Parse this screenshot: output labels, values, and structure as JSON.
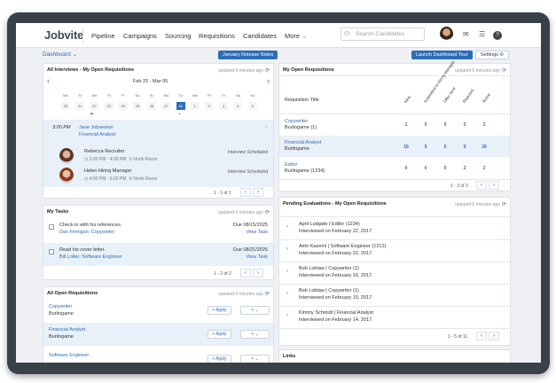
{
  "app": {
    "logo": "Jobvite"
  },
  "nav": {
    "items": [
      "Pipeline",
      "Campaigns",
      "Sourcing",
      "Requisitions",
      "Candidates",
      "More"
    ],
    "more_chevron": "⌄",
    "search_placeholder": "Search Candidates",
    "search_icon_glyph": "⚇",
    "mail_glyph": "✉",
    "list_glyph": "☰",
    "help_glyph": "?"
  },
  "subbar": {
    "dashboard": "Dashboard ⌄",
    "release_notes": "January Release Notes",
    "launch_tour": "Launch Dashboard Tour",
    "settings": "Settings",
    "settings_icon": "⚙"
  },
  "interviews": {
    "title": "All Interviews - My Open Requisitions",
    "updated": "updated 6 minutes ago",
    "refresh": "⟳",
    "range": "Feb 20 - Mar 05",
    "prev": "‹",
    "next": "›",
    "days": [
      "Mo",
      "Tu",
      "We",
      "Th",
      "Fr",
      "Sa",
      "Su",
      "Mo",
      "Tu",
      "We",
      "Th",
      "Fr",
      "Sa",
      "Su"
    ],
    "dates": [
      "20",
      "21",
      "22",
      "23",
      "24",
      "25",
      "26",
      "27",
      "28",
      "1",
      "2",
      "3",
      "4",
      "5"
    ],
    "selected_index": 8,
    "event": {
      "time": "3:00 PM",
      "candidate": "Jane Jobseeker",
      "role": "Financial Analyst",
      "close": "×",
      "interviewers": [
        {
          "name": "Rebecca Recruiter",
          "time": "3:00 PM - 4:00 PM",
          "place": "North Room",
          "status": "Interview Scheduled"
        },
        {
          "name": "Helen Hiring Manager",
          "time": "4:00 PM - 5:00 PM",
          "place": "North Room",
          "status": "Interview Scheduled"
        }
      ],
      "clock_glyph": "◷",
      "pin_glyph": "⚲"
    },
    "pager": "1 - 1 of 1",
    "pager_prev": "‹",
    "pager_next": "›"
  },
  "tasks": {
    "title": "My Tasks",
    "updated": "updated 6 minutes ago",
    "refresh": "⟳",
    "items": [
      {
        "text": "Check in with his references.",
        "link": "Dan Finnigan: Copywriter",
        "due": "Due 08/15/2025",
        "action": "View Task"
      },
      {
        "text": "Read his cover letter.",
        "link": "Bill Loller: Software Engineer",
        "due": "Due 08/21/2025",
        "action": "View Task"
      }
    ],
    "pager": "1 - 2 of 2",
    "pager_prev": "‹",
    "pager_next": "›"
  },
  "open_reqs": {
    "title": "All Open Requisitions",
    "updated": "updated 6 minutes ago",
    "refresh": "⟳",
    "apply_label": "+ Apply",
    "share_label": "< ⌄",
    "items": [
      {
        "title": "Copywriter",
        "location": "Burlingame"
      },
      {
        "title": "Financial Analyst",
        "location": "Burlingame"
      },
      {
        "title": "Software Engineer",
        "location": ""
      }
    ]
  },
  "my_reqs": {
    "title": "My Open Requisitions",
    "updated": "updated 6 minutes ago",
    "refresh": "⟳",
    "col_title": "Requisition Title",
    "columns": [
      "New",
      "Submitted to Hiring Manager",
      "Offer Sent",
      "Rejected",
      "Active"
    ],
    "rows": [
      {
        "title": "Copywriter",
        "sub": "Burlingame (1)",
        "values": [
          "1",
          "0",
          "0",
          "2",
          "2"
        ]
      },
      {
        "title": "Financial Analyst",
        "sub": "Burlingame",
        "values": [
          "15",
          "5",
          "0",
          "0",
          "26"
        ]
      },
      {
        "title": "Editor",
        "sub": "Burlingame (1234)",
        "values": [
          "0",
          "0",
          "0",
          "2",
          "2"
        ]
      }
    ],
    "pager": "1 - 3 of 3",
    "pager_prev": "‹",
    "pager_next": "›"
  },
  "evals": {
    "title": "Pending Evaluations - My Open Requisitions",
    "updated": "updated 6 minutes ago",
    "refresh": "⟳",
    "expander": "›",
    "items": [
      {
        "who": "April Ludgate  |  Editor (1234)",
        "when": "Interviewed on February 22, 2017"
      },
      {
        "who": "Amir Kazemi  |  Software Engineer (1212)",
        "when": "Interviewed on February 22, 2017"
      },
      {
        "who": "Bob Loblaw  |  Copywriter (1)",
        "when": "Interviewed on February 16, 2017"
      },
      {
        "who": "Bob Loblaw  |  Copywriter (1)",
        "when": "Interviewed on February 15, 2017"
      },
      {
        "who": "Kimmy Schmidt  |  Financial Analyst",
        "when": "Interviewed on February 14, 2017"
      }
    ],
    "pager": "1 - 5 of 11",
    "pager_prev": "‹",
    "pager_next": "›"
  },
  "links": {
    "title": "Links"
  }
}
